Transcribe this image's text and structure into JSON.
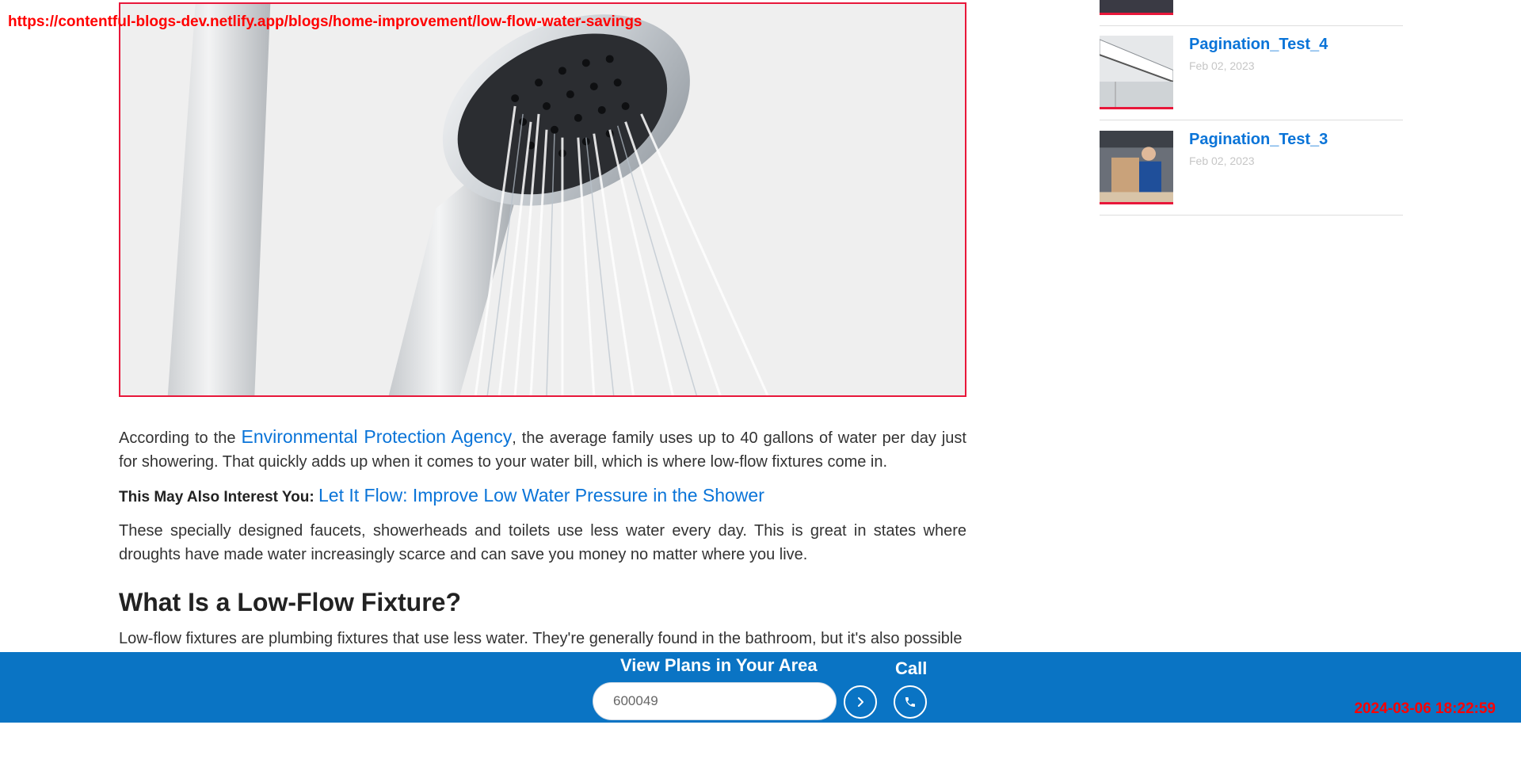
{
  "overlay": {
    "url": "https://contentful-blogs-dev.netlify.app/blogs/home-improvement/low-flow-water-savings",
    "timestamp": "2024-03-06 18:22:59"
  },
  "article": {
    "p1_before": "According to the ",
    "p1_link": "Environmental Protection Agency",
    "p1_after": ", the average family uses up to 40 gallons of water per day just for showering. That quickly adds up when it comes to your water bill, which is where low-flow fixtures come in.",
    "interest_label": "This May Also Interest You:",
    "interest_link": "Let It Flow: Improve Low Water Pressure in the Shower",
    "p3": "These specially designed faucets, showerheads and toilets use less water every day. This is great in states where droughts have made water increasingly scarce and can save you money no matter where you live.",
    "heading": "What Is a Low-Flow Fixture?",
    "p4": "Low-flow fixtures are plumbing fixtures that use less water. They're generally found in the bathroom, but it's also possible"
  },
  "sidebar": {
    "items": [
      {
        "title": "Pagination_Test_4",
        "date": "Feb 02, 2023"
      },
      {
        "title": "Pagination_Test_3",
        "date": "Feb 02, 2023"
      }
    ]
  },
  "cta": {
    "title": "View Plans in Your Area",
    "zip_value": "600049",
    "call_label": "Call"
  },
  "colors": {
    "accent_blue": "#0a74c4",
    "link_blue": "#0a74d8",
    "border_red": "#e8173a"
  },
  "icons": {
    "go": "chevron-right-icon",
    "call": "phone-icon"
  }
}
